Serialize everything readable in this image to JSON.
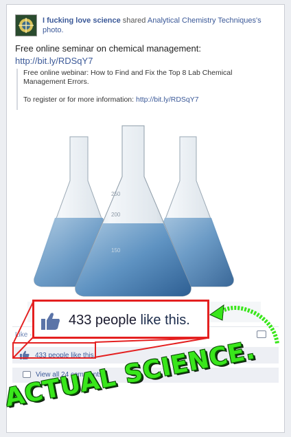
{
  "post": {
    "author": "I fucking love science",
    "action": "shared",
    "source": "Analytical Chemistry Techniques's",
    "object": "photo.",
    "status_text": "Free online seminar on chemical management:",
    "status_link": "http://bit.ly/RDSqY7",
    "quote_line1": "Free online webinar: How to Find and Fix the Top 8 Lab Chemical Management Errors.",
    "quote_line2": "To register or for more information:",
    "quote_link": "http://bit.ly/RDSqY7"
  },
  "photo": {
    "flask_marks": [
      "250",
      "200",
      "150"
    ]
  },
  "actions": {
    "like_label": "Like ·",
    "likes_text": "433 people like this.",
    "comments_text": "View all 24 comments"
  },
  "overlay": {
    "callout_count": "433 people",
    "callout_rest": "like this.",
    "caption": "ACTUAL SCIENCE."
  },
  "colors": {
    "link": "#3b5998",
    "callout_border": "#e42020",
    "caption_green": "#39e61b"
  },
  "icons": [
    "thumbs-up-icon",
    "comment-icon",
    "page-avatar-icon"
  ]
}
